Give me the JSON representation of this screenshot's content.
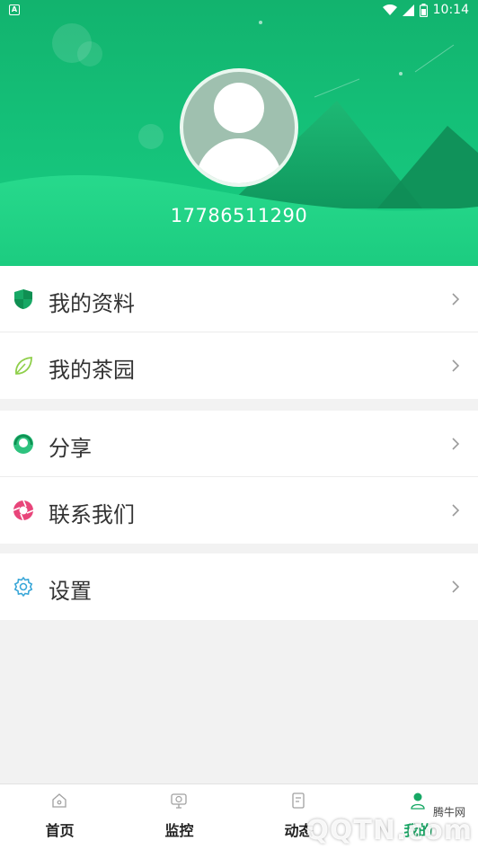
{
  "status_bar": {
    "left_badge": "A",
    "time": "10:14",
    "battery_label": "8"
  },
  "profile": {
    "phone": "17786511290"
  },
  "menu": {
    "group1": [
      {
        "label": "我的资料",
        "icon": "shield-icon"
      },
      {
        "label": "我的茶园",
        "icon": "leaf-icon"
      }
    ],
    "group2": [
      {
        "label": "分享",
        "icon": "share-icon"
      },
      {
        "label": "联系我们",
        "icon": "contact-icon"
      }
    ],
    "group3": [
      {
        "label": "设置",
        "icon": "gear-icon"
      }
    ]
  },
  "bottom_nav": [
    {
      "label": "首页",
      "icon": "home-icon"
    },
    {
      "label": "监控",
      "icon": "monitor-icon"
    },
    {
      "label": "动态",
      "icon": "news-icon"
    },
    {
      "label": "我的",
      "icon": "user-icon"
    }
  ],
  "watermark": {
    "text": "QQTN.com",
    "sub": "腾牛网"
  },
  "colors": {
    "primary": "#15c27a",
    "accent_pink": "#e8457a",
    "gear_blue": "#3aa7d8",
    "leaf_green": "#8fcf4a"
  }
}
